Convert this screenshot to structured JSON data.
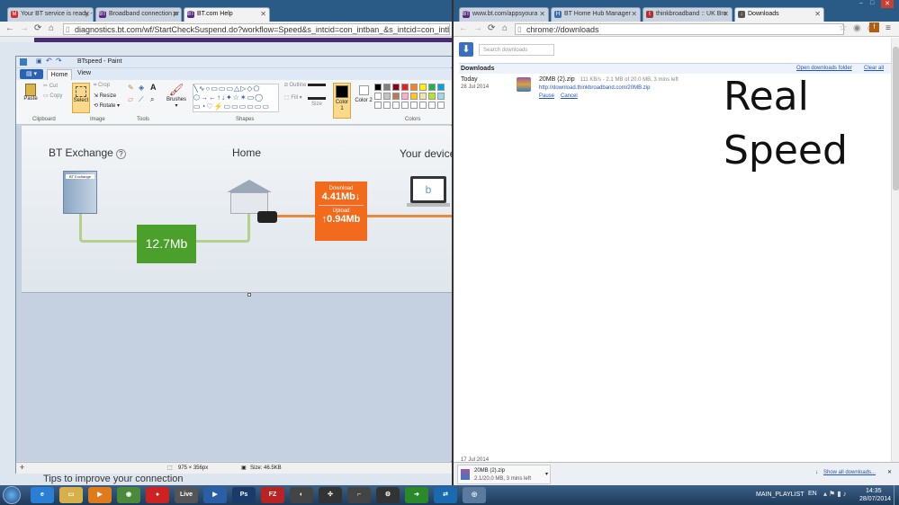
{
  "left_browser": {
    "tabs": [
      {
        "label": "Your BT service is ready -",
        "icon": "gmail-icon",
        "favicon_text": "M",
        "color": "#c33"
      },
      {
        "label": "Broadband connection pr",
        "icon": "bt-icon",
        "favicon_text": "BT",
        "color": "#5a2a82"
      },
      {
        "label": "BT.com Help",
        "icon": "bt-icon",
        "favicon_text": "BT",
        "color": "#5a2a82"
      }
    ],
    "url": "diagnostics.bt.com/wf/StartCheckSuspend.do?workflow=Speed&s_intcid=con_intban_&s_intcid=con_intban_FORUM",
    "page_footer_text": "Tips to improve your connection"
  },
  "paint": {
    "title": "BTspeed - Paint",
    "tabs": [
      "Home",
      "View"
    ],
    "clipboard": {
      "paste": "Paste",
      "cut": "Cut",
      "copy": "Copy",
      "group": "Clipboard"
    },
    "image": {
      "select": "Select",
      "crop": "Crop",
      "resize": "Resize",
      "rotate": "Rotate",
      "group": "Image"
    },
    "tools_group": "Tools",
    "brushes": "Brushes",
    "shapes_group": "Shapes",
    "outline": "Outline",
    "fill": "Fill",
    "size": "Size",
    "color1": "Color 1",
    "color2": "Color 2",
    "colors_group": "Colors",
    "palette": [
      "#000000",
      "#7f7f7f",
      "#880015",
      "#ed1c24",
      "#ff7f27",
      "#fff200",
      "#22b14c",
      "#00a2e8",
      "#ffffff",
      "#c3c3c3",
      "#b97a57",
      "#ffaec9",
      "#ffc90e",
      "#efe4b0",
      "#b5e61d",
      "#99d9ea"
    ],
    "status_dimensions": "975 × 356px",
    "status_size": "Size: 46.5KB"
  },
  "speed_diagram": {
    "bt_exchange": "BT Exchange",
    "exchange_sign": "BT Exchange",
    "home": "Home",
    "your_device": "Your device",
    "line_speed": "12.7Mb",
    "download_label": "Download",
    "download_value": "4.41Mb",
    "upload_label": "Upload",
    "upload_value": "0.94Mb"
  },
  "right_browser": {
    "tabs": [
      {
        "label": "www.bt.com/appsyoura",
        "icon": "bt-icon",
        "favicon_text": "BT",
        "color": "#5a2a82"
      },
      {
        "label": "BT Home Hub Manager",
        "icon": "hub-icon",
        "favicon_text": "H",
        "color": "#3a6fb0"
      },
      {
        "label": "thinkbroadband :: UK Bro",
        "icon": "tb-icon",
        "favicon_text": "t",
        "color": "#a33"
      },
      {
        "label": "Downloads",
        "icon": "download-icon",
        "favicon_text": "↓",
        "color": "#555"
      }
    ],
    "url": "chrome://downloads",
    "search_placeholder": "Search downloads",
    "heading": "Downloads",
    "open_folder": "Open downloads folder",
    "clear_all": "Clear all",
    "today": "Today",
    "date": "28 Jul 2014",
    "file_name": "20MB (2).zip",
    "progress": "111 KB/s - 2.1 MB of 20.0 MB, 3 mins left",
    "file_url": "http://download.thinkbroadband.com/20MB.zip",
    "pause": "Pause",
    "cancel": "Cancel",
    "overlay_line1": "Real",
    "overlay_line2": "Speed",
    "older_date": "17 Jul 2014",
    "shelf_file": "20MB (2).zip",
    "shelf_progress": "2.1/20.0 MB, 3 mins left",
    "show_all": "Show all downloads..."
  },
  "taskbar": {
    "icons": [
      {
        "name": "ie-icon",
        "text": "e",
        "color": "#2a7fd4"
      },
      {
        "name": "explorer-icon",
        "text": "▭",
        "color": "#d8b04a"
      },
      {
        "name": "media-icon",
        "text": "▶",
        "color": "#e07a1a"
      },
      {
        "name": "chrome-icon",
        "text": "◉",
        "color": "#4a8a3a"
      },
      {
        "name": "app-icon",
        "text": "●",
        "color": "#c22"
      },
      {
        "name": "live-icon",
        "text": "Live",
        "color": "#555"
      },
      {
        "name": "player-icon",
        "text": "▶",
        "color": "#2a5fa8"
      },
      {
        "name": "photoshop-icon",
        "text": "Ps",
        "color": "#1a3a6a"
      },
      {
        "name": "filezilla-icon",
        "text": "FZ",
        "color": "#b22"
      },
      {
        "name": "skype-icon",
        "text": "◐",
        "color": "#444"
      },
      {
        "name": "app2-icon",
        "text": "✣",
        "color": "#333"
      },
      {
        "name": "gun-icon",
        "text": "⌐",
        "color": "#444"
      },
      {
        "name": "steam-icon",
        "text": "⚙",
        "color": "#333"
      },
      {
        "name": "arrow-icon",
        "text": "➜",
        "color": "#2a8a2a"
      },
      {
        "name": "teamviewer-icon",
        "text": "⇄",
        "color": "#1a6ab0"
      },
      {
        "name": "app3-icon",
        "text": "◎",
        "color": "#5a7aa0"
      }
    ],
    "playlist": "MAIN_PLAYLIST",
    "lang": "EN",
    "time": "14:35",
    "date": "28/07/2014"
  }
}
